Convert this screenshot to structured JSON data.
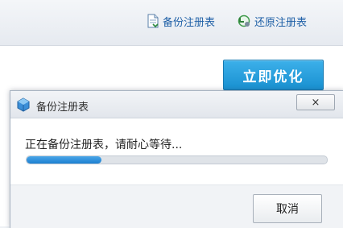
{
  "header": {
    "backup_link": {
      "label": "备份注册表",
      "icon": "document-backup-icon"
    },
    "restore_link": {
      "label": "还原注册表",
      "icon": "restore-arrow-icon"
    }
  },
  "main": {
    "optimize_label": "立即优化"
  },
  "dialog": {
    "title": "备份注册表",
    "title_icon": "cube-app-icon",
    "close_glyph": "×",
    "status_text": "正在备份注册表，请耐心等待...",
    "progress_percent": 25,
    "cancel_label": "取消"
  },
  "colors": {
    "accent": "#1e8fd6",
    "link": "#1e5fa6",
    "progress": "#2b8ddb"
  }
}
